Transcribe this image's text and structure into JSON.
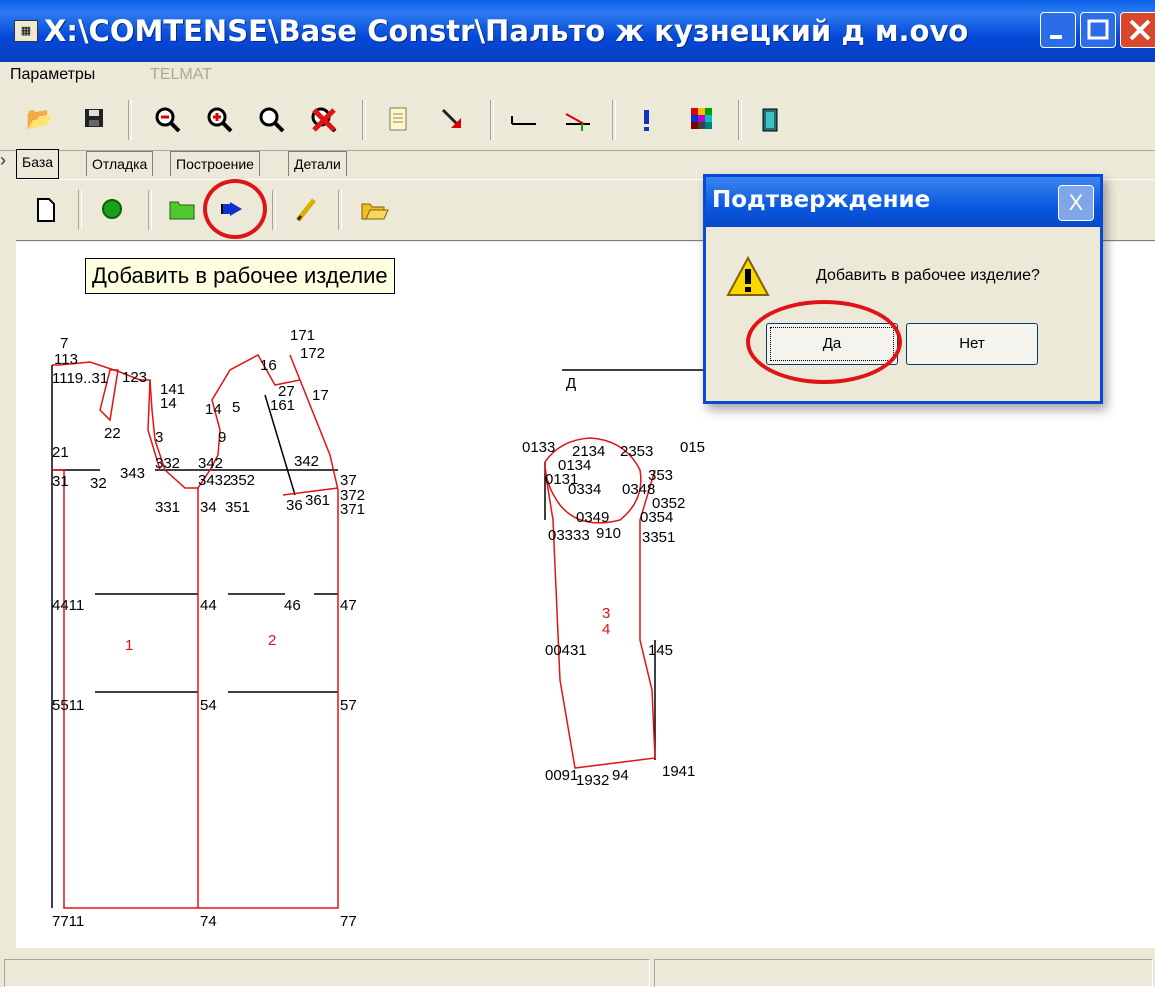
{
  "window": {
    "title": "X:\\COMTENSE\\Base Constr\\Пальто ж кузнецкий д м.ovo",
    "colors": {
      "titlebar": "#0a5fe8",
      "face": "#ece9d8",
      "pattern_line": "#e01414",
      "annotation": "#e01414"
    }
  },
  "menubar": {
    "items": [
      "Параметры",
      "TELMAT"
    ]
  },
  "toolbar": {
    "icons": [
      "open-folder-icon",
      "save-icon",
      "zoom-out-icon",
      "zoom-in-icon",
      "zoom-icon",
      "delete-icon",
      "document-icon",
      "pointer-arrow-icon",
      "measure-line-icon",
      "measure-angle-icon",
      "exclamation-icon",
      "color-grid-icon",
      "exit-door-icon"
    ]
  },
  "tabs": [
    "База",
    "Отладка",
    "Построение",
    "Детали"
  ],
  "active_tab": "База",
  "subtoolbar": {
    "icons": [
      "new-document-icon",
      "green-circle-icon",
      "folder-icon",
      "add-to-product-icon",
      "pencil-icon",
      "open-folder-icon"
    ]
  },
  "tooltip": {
    "text": "Добавить в рабочее изделие"
  },
  "dialog": {
    "title": "Подтверждение",
    "message": "Добавить в рабочее изделие?",
    "yes_label": "Да",
    "no_label": "Нет",
    "close_label": "X"
  },
  "drawing": {
    "labels": {
      "p7": "7",
      "p113": "113",
      "p1119": "1119..31",
      "p123": "123",
      "p141": "141",
      "p14": "14",
      "p22": "22",
      "p3": "3",
      "p21": "21",
      "p31": "31",
      "p32": "32",
      "p343": "343",
      "p332": "332",
      "p342": "342",
      "p3432": "3432",
      "p352": "352",
      "p331": "331",
      "p34": "34",
      "p351": "351",
      "p36": "36",
      "p361": "361",
      "p37": "37",
      "p372": "372",
      "p371": "371",
      "p171": "171",
      "p172": "172",
      "p16": "16",
      "p27": "27",
      "p17": "17",
      "p161": "161",
      "p145b": "14",
      "p5": "5",
      "p9": "9",
      "p342b": "342",
      "p4411": "4411",
      "p44": "44",
      "p46": "46",
      "p47": "47",
      "p5511": "5511",
      "p54": "54",
      "p57": "57",
      "p7711": "7711",
      "p74": "74",
      "p77": "77",
      "piece1": "1",
      "piece2": "2",
      "piece34": "3\n4",
      "pD": "Д",
      "s0133": "0133",
      "s2134": "2134",
      "s2353": "2353",
      "s015": "015",
      "s0134": "0134",
      "s353": "353",
      "s0131": "0131",
      "s0334": "0334",
      "s0348": "0348",
      "s0352": "0352",
      "s0349": "0349",
      "s0354": "0354",
      "s03333": "03333",
      "s910": "910",
      "s3351": "3351",
      "s0431": "00431",
      "s145": "145",
      "s0091": "0091",
      "s1932": "1932",
      "s94": "94",
      "s1941": "1941"
    }
  }
}
